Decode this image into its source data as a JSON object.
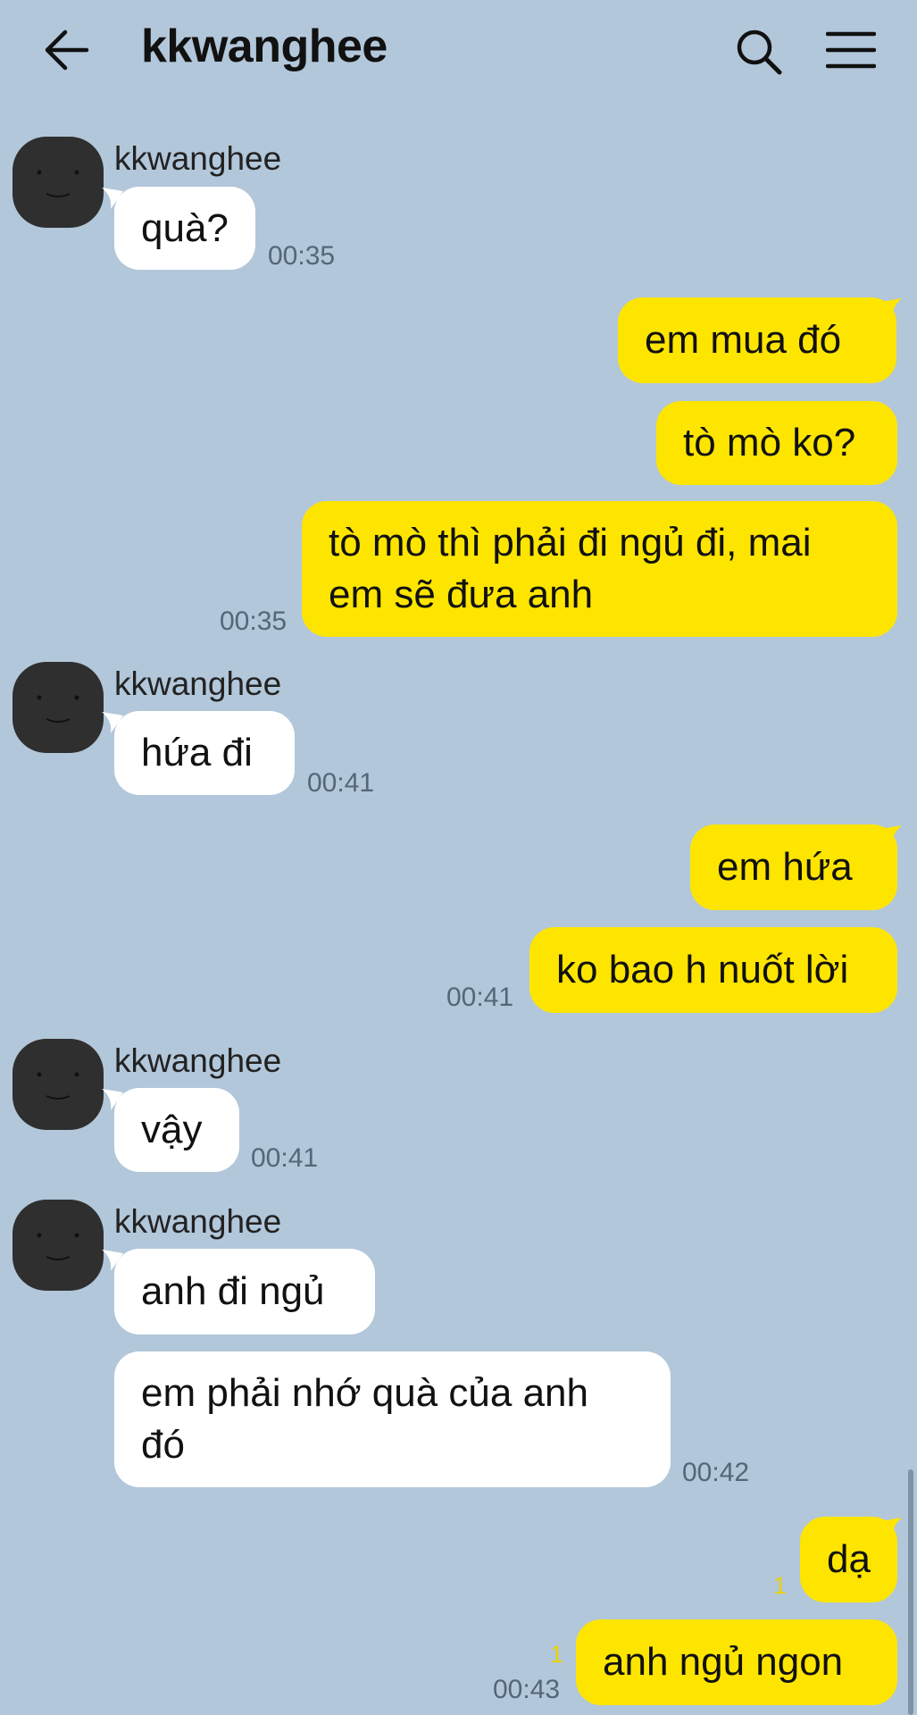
{
  "header": {
    "title": "kkwanghee",
    "back_icon": "arrow-left-icon",
    "search_icon": "search-icon",
    "menu_icon": "hamburger-menu-icon"
  },
  "colors": {
    "background": "#b2c7da",
    "incoming_bubble": "#ffffff",
    "outgoing_bubble": "#fee500",
    "unread_count": "#e8d200"
  },
  "messages": [
    {
      "sender": "kkwanghee",
      "text": "quà?",
      "time": "00:35"
    },
    {
      "text": "em mua đó"
    },
    {
      "text": "tò mò ko?"
    },
    {
      "text_line1": "tò mò thì phải đi ngủ đi, mai",
      "text_line2": "em sẽ đưa anh",
      "time": "00:35"
    },
    {
      "sender": "kkwanghee",
      "text": "hứa đi",
      "time": "00:41"
    },
    {
      "text": "em hứa"
    },
    {
      "text": "ko bao h nuốt lời",
      "time": "00:41"
    },
    {
      "sender": "kkwanghee",
      "text": "vậy",
      "time": "00:41"
    },
    {
      "sender": "kkwanghee",
      "text": "anh đi ngủ"
    },
    {
      "text_line1": "em phải nhớ quà của anh",
      "text_line2": "đó",
      "time": "00:42"
    },
    {
      "text": "dạ",
      "unread": "1"
    },
    {
      "text": "anh ngủ ngon",
      "unread": "1",
      "time": "00:43"
    }
  ]
}
